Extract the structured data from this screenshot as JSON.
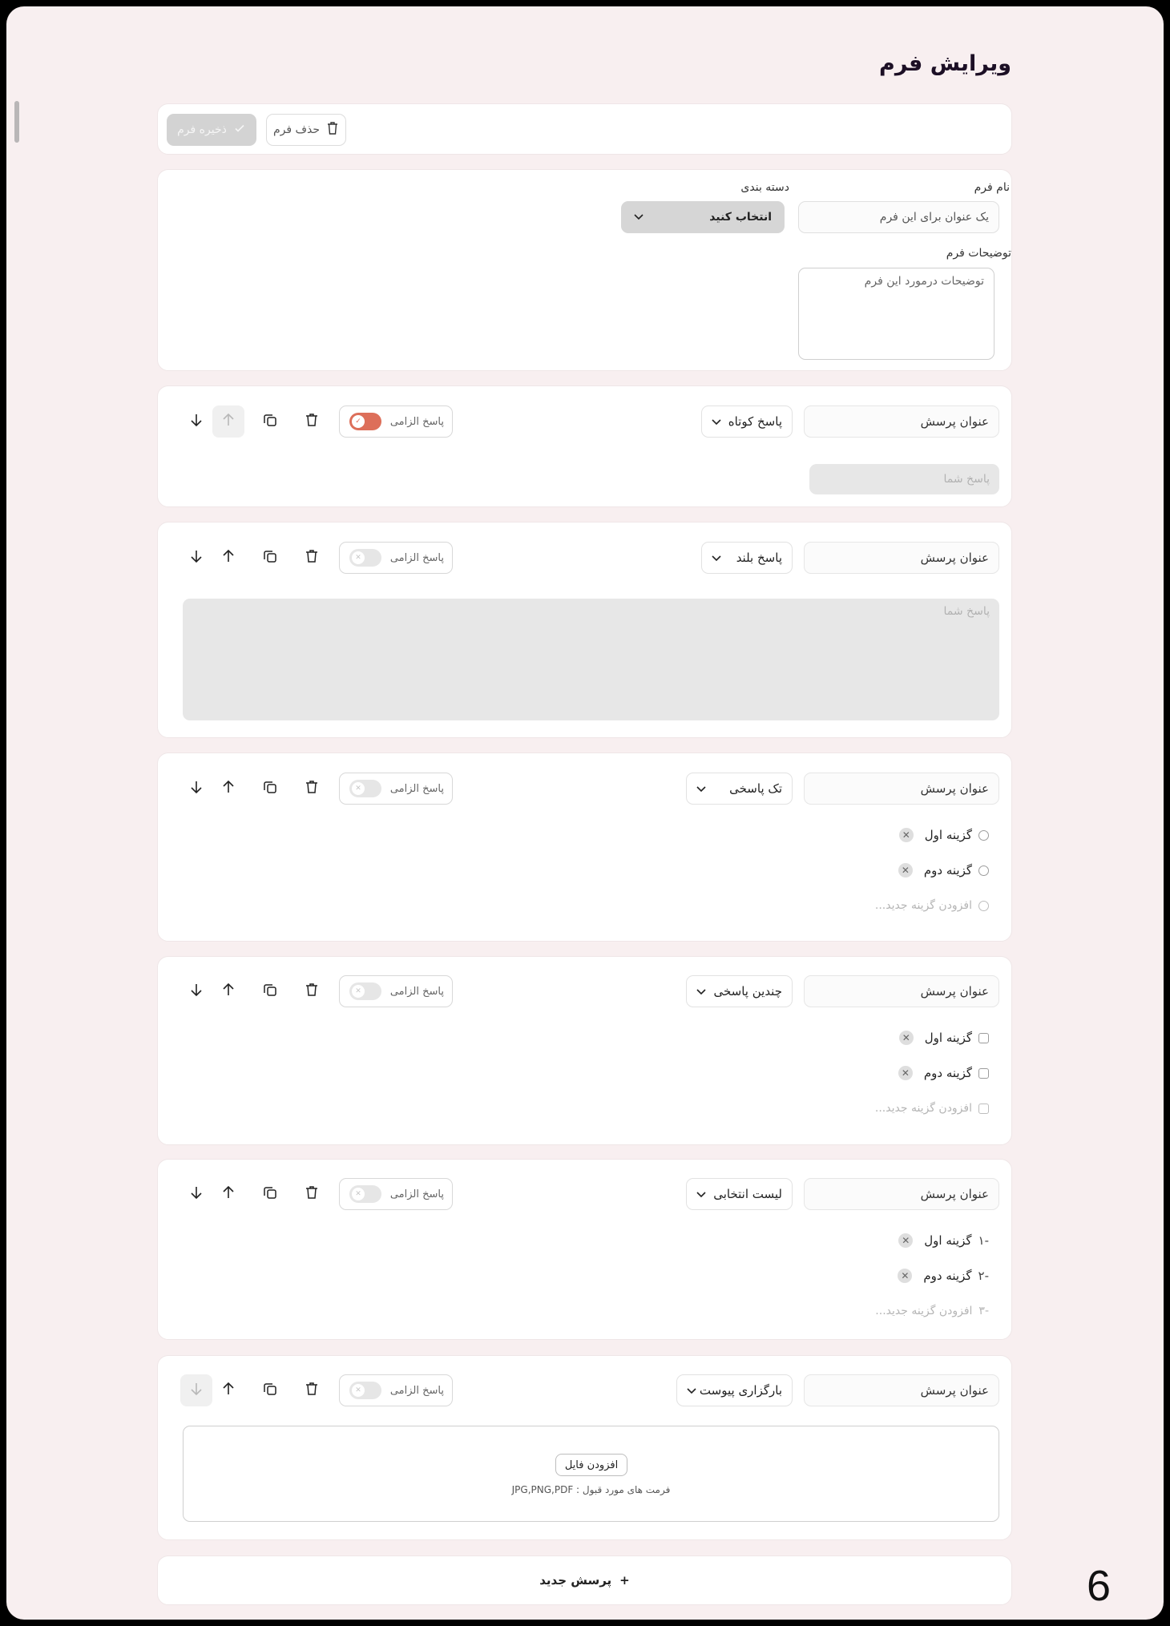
{
  "page": {
    "title": "ویرایش فرم",
    "page_number": "6"
  },
  "toolbar": {
    "delete_label": "حذف فرم",
    "save_label": "ذخیره فرم"
  },
  "form_meta": {
    "name_label": "نام فرم",
    "name_placeholder": "یک عنوان برای این فرم",
    "category_label": "دسته بندی",
    "category_value": "انتخاب کنید",
    "desc_label": "توضیحات فرم",
    "desc_placeholder": "توضیحات درمورد این فرم"
  },
  "common": {
    "question_title": "عنوان پرسش",
    "required_label": "پاسخ الزامی",
    "answer_placeholder": "پاسخ شما",
    "add_option": "افزودن گزینه جدید..."
  },
  "questions": [
    {
      "type": "پاسخ کوتاه",
      "required": true
    },
    {
      "type": "پاسخ بلند",
      "required": false
    },
    {
      "type": "تک پاسخی",
      "required": false,
      "options": [
        "گزینه اول",
        "گزینه دوم"
      ]
    },
    {
      "type": "چندین پاسخی",
      "required": false,
      "options": [
        "گزینه اول",
        "گزینه دوم"
      ]
    },
    {
      "type": "لیست انتخابی",
      "required": false,
      "options": [
        "گزینه اول",
        "گزینه دوم"
      ],
      "numbers": [
        "-۱",
        "-۲",
        "-۳"
      ]
    },
    {
      "type": "بارگزاری پیوست",
      "required": false,
      "upload_button": "افزودن فایل",
      "accepted_formats": "فرمت های مورد قبول : JPG,PNG,PDF"
    }
  ],
  "new_question_label": "پرسش جدید",
  "colors": {
    "background": "#f8eff0",
    "accent": "#dd6f5a",
    "card": "#ffffff"
  }
}
